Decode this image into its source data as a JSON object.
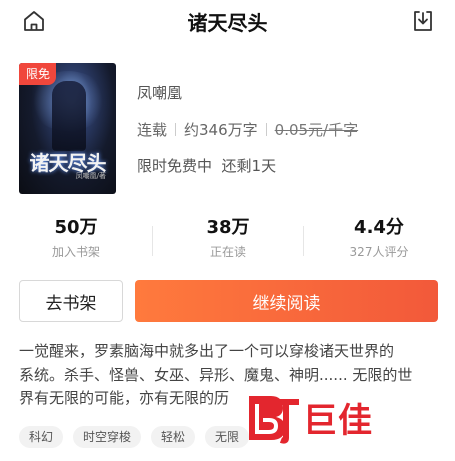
{
  "header": {
    "title": "诸天尽头",
    "home_icon": "home-icon",
    "download_icon": "download-icon"
  },
  "book": {
    "badge": "限免",
    "cover_title": "诸天尽头",
    "cover_author": "凤嘲凰/著",
    "author": "凤嘲凰",
    "status": "连载",
    "word_count": "约346万字",
    "price": "0.05元/千字",
    "free_notice": "限时免费中  还剩1天"
  },
  "stats": [
    {
      "value": "50万",
      "label": "加入书架"
    },
    {
      "value": "38万",
      "label": "正在读"
    },
    {
      "value": "4.4分",
      "label": "327人评分"
    }
  ],
  "actions": {
    "add_shelf": "去书架",
    "continue_read": "继续阅读"
  },
  "description": {
    "line1": "一觉醒来，罗素脑海中就多出了一个可以穿梭诸天世界的",
    "line2": "系统。杀手、怪兽、女巫、异形、魔鬼、神明...... 无限的世",
    "line3": "界有无限的可能，亦有无限的历"
  },
  "tags": [
    "科幻",
    "时空穿梭",
    "轻松",
    "无限"
  ],
  "watermark": {
    "text": "巨佳"
  },
  "colors": {
    "accent": "#f2593a",
    "badge": "#f0473c",
    "watermark": "#e3262e"
  }
}
